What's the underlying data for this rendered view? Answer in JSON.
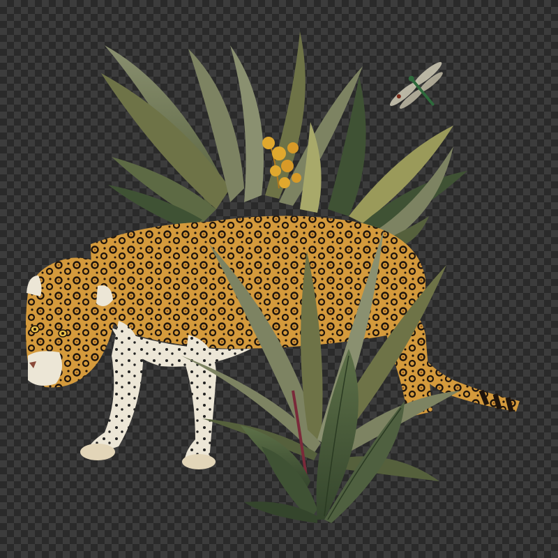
{
  "image": {
    "subject": "jaguar-with-tropical-foliage",
    "background": "transparency-checkerboard"
  },
  "colors": {
    "checker_dark": "#2a2a2a",
    "checker_light": "#3c3c3c",
    "jaguar_fur": "#d49a3c",
    "jaguar_fur_light": "#e8b860",
    "jaguar_belly": "#ece6d6",
    "spot": "#1e140c",
    "leaf_olive": "#6e7347",
    "leaf_dark": "#3f5234",
    "leaf_grey": "#8a9070",
    "leaf_stem": "#7a2a3a",
    "fern_yellow": "#e0a82e",
    "dragonfly_wing": "#c9c4b0",
    "dragonfly_body": "#2e6a3c"
  },
  "icons": [
    "jaguar-illustration",
    "dragonfly-icon",
    "fern-leaf",
    "palm-leaf",
    "spiky-leaf"
  ]
}
